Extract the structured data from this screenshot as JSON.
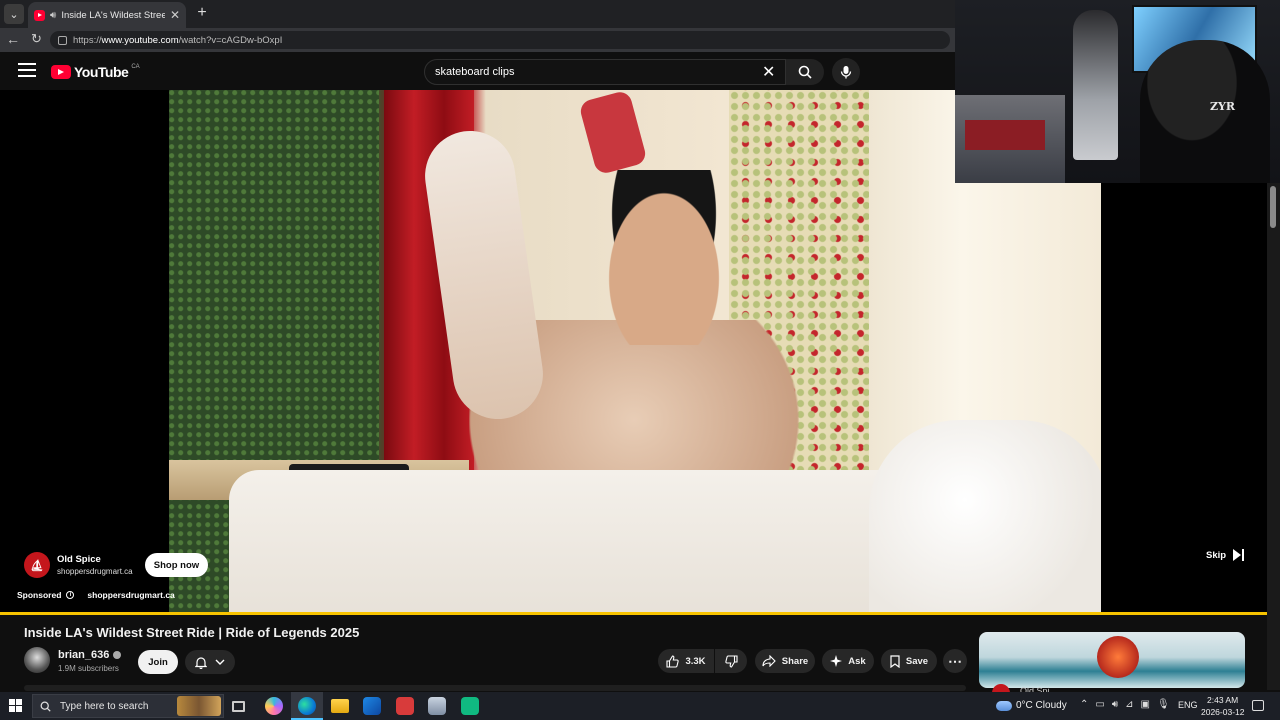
{
  "browser": {
    "tab_title": "Inside LA's Wildest Street Ride",
    "new_tab": "+",
    "url_prefix": "https://",
    "url_host": "www.youtube.com",
    "url_path": "/watch?v=cAGDw-bOxpI"
  },
  "youtube": {
    "logo_text": "YouTube",
    "country_code": "CA",
    "search_value": "skateboard clips"
  },
  "ad": {
    "advertiser": "Old Spice",
    "domain": "shoppersdrugmart.ca",
    "cta": "Shop now",
    "sponsored_label": "Sponsored",
    "sponsored_domain": "shoppersdrugmart.ca",
    "skip_label": "Skip",
    "progress_fraction": 1.0
  },
  "video": {
    "title": "Inside LA's Wildest Street Ride | Ride of Legends 2025",
    "channel": "brian_636",
    "subscribers": "1.9M subscribers",
    "join": "Join",
    "likes": "3.3K",
    "share": "Share",
    "ask": "Ask",
    "save": "Save",
    "more": "⋯"
  },
  "webcam": {
    "shirt_text": "ZYR"
  },
  "recommended": {
    "channel_partial": "Old Spi"
  },
  "taskbar": {
    "search_placeholder": "Type here to search",
    "weather": "0°C  Cloudy",
    "language": "ENG",
    "time": "2:43 AM",
    "date": "2026-03-12"
  },
  "colors": {
    "youtube_red": "#ff0033",
    "ad_progress": "#f7c300",
    "accent_blue": "#4cc2ff"
  }
}
